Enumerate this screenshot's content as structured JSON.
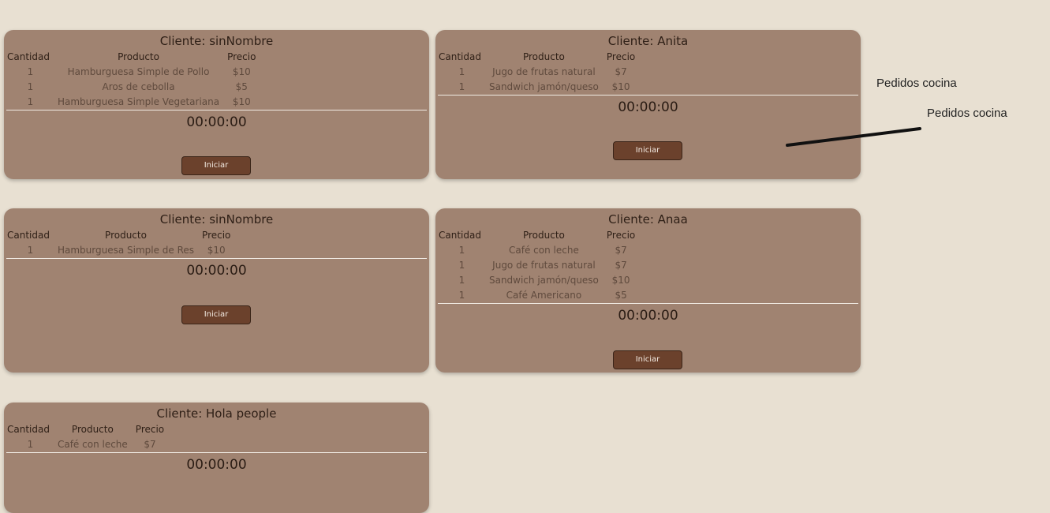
{
  "headers": {
    "quantity": "Cantidad",
    "product": "Producto",
    "price": "Precio"
  },
  "orders": [
    {
      "client_title": "Cliente: sinNombre",
      "items": [
        {
          "qty": "1",
          "product": "Hamburguesa Simple de Pollo",
          "price": "$10"
        },
        {
          "qty": "1",
          "product": "Aros de cebolla",
          "price": "$5"
        },
        {
          "qty": "1",
          "product": "Hamburguesa Simple Vegetariana",
          "price": "$10"
        }
      ],
      "timer": "00:00:00",
      "button_label": "Iniciar"
    },
    {
      "client_title": "Cliente: Anita",
      "items": [
        {
          "qty": "1",
          "product": "Jugo de frutas natural",
          "price": "$7"
        },
        {
          "qty": "1",
          "product": "Sandwich jamón/queso",
          "price": "$10"
        }
      ],
      "timer": "00:00:00",
      "button_label": "Iniciar"
    },
    {
      "client_title": "Cliente: sinNombre",
      "items": [
        {
          "qty": "1",
          "product": "Hamburguesa Simple de Res",
          "price": "$10"
        }
      ],
      "timer": "00:00:00",
      "button_label": "Iniciar"
    },
    {
      "client_title": "Cliente: Anaa",
      "items": [
        {
          "qty": "1",
          "product": "Café con leche",
          "price": "$7"
        },
        {
          "qty": "1",
          "product": "Jugo de frutas natural",
          "price": "$7"
        },
        {
          "qty": "1",
          "product": "Sandwich jamón/queso",
          "price": "$10"
        },
        {
          "qty": "1",
          "product": "Café Americano",
          "price": "$5"
        }
      ],
      "timer": "00:00:00",
      "button_label": "Iniciar"
    },
    {
      "client_title": "Cliente: Hola people",
      "items": [
        {
          "qty": "1",
          "product": "Café con leche",
          "price": "$7"
        }
      ],
      "timer": "00:00:00"
    }
  ],
  "side": {
    "label": "Pedidos cocina",
    "label_clipped": "Pedidos cocina"
  }
}
